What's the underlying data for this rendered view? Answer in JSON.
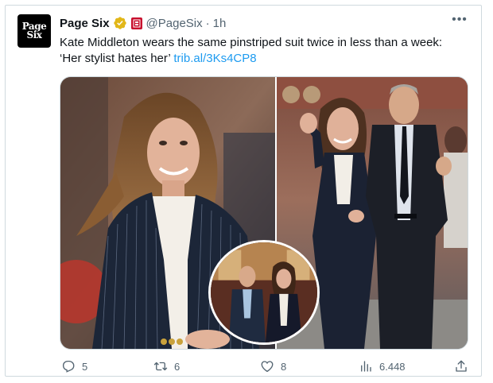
{
  "tweet": {
    "avatar_line1": "Page",
    "avatar_line2": "Six",
    "display_name": "Page Six",
    "affiliate_badge": "NYP",
    "handle": "@PageSix",
    "separator": "·",
    "time": "1h",
    "more_label": "•••",
    "text": "Kate Middleton wears the same pinstriped suit twice in less than a week: ‘Her stylist hates her’ ",
    "link": "trib.al/3Ks4CP8"
  },
  "actions": {
    "replies": "5",
    "retweets": "6",
    "likes": "8",
    "views": "6.448"
  },
  "colors": {
    "link": "#1d9bf0",
    "verified_gold": "#e2b719",
    "affiliate_red": "#c8102e",
    "muted": "#536471"
  },
  "icons": [
    "page-six-avatar",
    "verified-gold-icon",
    "affiliate-badge-icon",
    "more-icon",
    "reply-icon",
    "retweet-icon",
    "like-icon",
    "views-icon",
    "share-icon"
  ]
}
